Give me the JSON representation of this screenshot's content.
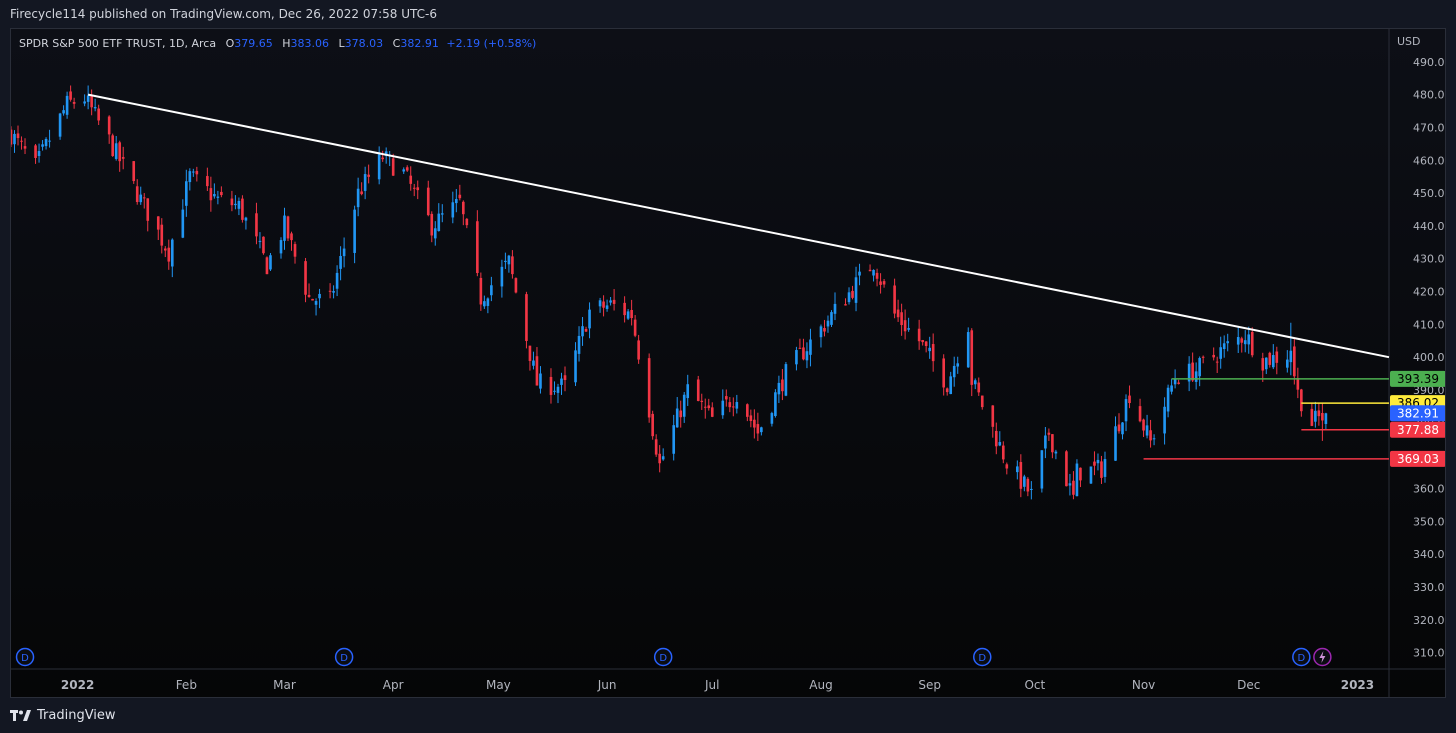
{
  "header": {
    "published_text": "Firecycle114 published on TradingView.com, Dec 26, 2022 07:58 UTC-6"
  },
  "legend": {
    "symbol": "SPDR S&P 500 ETF TRUST, 1D, Arca",
    "o_label": "O",
    "o_value": "379.65",
    "h_label": "H",
    "h_value": "383.06",
    "l_label": "L",
    "l_value": "378.03",
    "c_label": "C",
    "c_value": "382.91",
    "change": "+2.19 (+0.58%)"
  },
  "footer": {
    "brand": "TradingView"
  },
  "colors": {
    "up": "#2196f3",
    "down": "#f23645",
    "background": "#131722",
    "trendline": "#ffffff"
  },
  "chart_data": {
    "type": "candlestick",
    "currency_label": "USD",
    "ylim": [
      305,
      500
    ],
    "y_ticks": [
      310,
      320,
      330,
      340,
      350,
      360,
      370,
      380,
      390,
      400,
      410,
      420,
      430,
      440,
      450,
      460,
      470,
      480,
      490
    ],
    "x_range": [
      "2021-12-13",
      "2023-01-10"
    ],
    "x_ticks": [
      {
        "date": "2022-01-01",
        "label": "2022",
        "bold": true
      },
      {
        "date": "2022-02-01",
        "label": "Feb"
      },
      {
        "date": "2022-03-01",
        "label": "Mar"
      },
      {
        "date": "2022-04-01",
        "label": "Apr"
      },
      {
        "date": "2022-05-01",
        "label": "May"
      },
      {
        "date": "2022-06-01",
        "label": "Jun"
      },
      {
        "date": "2022-07-01",
        "label": "Jul"
      },
      {
        "date": "2022-08-01",
        "label": "Aug"
      },
      {
        "date": "2022-09-01",
        "label": "Sep"
      },
      {
        "date": "2022-10-01",
        "label": "Oct"
      },
      {
        "date": "2022-11-01",
        "label": "Nov"
      },
      {
        "date": "2022-12-01",
        "label": "Dec"
      },
      {
        "date": "2023-01-01",
        "label": "2023",
        "bold": true
      }
    ],
    "close_path": [
      [
        "2021-12-13",
        468
      ],
      [
        "2021-12-20",
        458
      ],
      [
        "2021-12-29",
        477
      ],
      [
        "2022-01-03",
        479
      ],
      [
        "2022-01-10",
        466
      ],
      [
        "2022-01-20",
        446
      ],
      [
        "2022-01-27",
        432
      ],
      [
        "2022-02-02",
        455
      ],
      [
        "2022-02-10",
        448
      ],
      [
        "2022-02-16",
        446
      ],
      [
        "2022-02-24",
        428
      ],
      [
        "2022-03-01",
        440
      ],
      [
        "2022-03-08",
        418
      ],
      [
        "2022-03-14",
        417
      ],
      [
        "2022-03-22",
        450
      ],
      [
        "2022-03-29",
        461
      ],
      [
        "2022-04-04",
        456
      ],
      [
        "2022-04-12",
        440
      ],
      [
        "2022-04-20",
        447
      ],
      [
        "2022-04-26",
        418
      ],
      [
        "2022-05-04",
        429
      ],
      [
        "2022-05-12",
        392
      ],
      [
        "2022-05-20",
        391
      ],
      [
        "2022-05-27",
        414
      ],
      [
        "2022-06-02",
        416
      ],
      [
        "2022-06-08",
        413
      ],
      [
        "2022-06-16",
        367
      ],
      [
        "2022-06-24",
        390
      ],
      [
        "2022-07-01",
        381
      ],
      [
        "2022-07-08",
        389
      ],
      [
        "2022-07-14",
        377
      ],
      [
        "2022-07-22",
        395
      ],
      [
        "2022-08-02",
        410
      ],
      [
        "2022-08-16",
        429
      ],
      [
        "2022-08-22",
        413
      ],
      [
        "2022-08-29",
        405
      ],
      [
        "2022-09-06",
        392
      ],
      [
        "2022-09-12",
        410
      ],
      [
        "2022-09-13",
        393
      ],
      [
        "2022-09-23",
        368
      ],
      [
        "2022-09-30",
        358
      ],
      [
        "2022-10-05",
        377
      ],
      [
        "2022-10-12",
        357
      ],
      [
        "2022-10-13",
        365
      ],
      [
        "2022-10-20",
        366
      ],
      [
        "2022-10-28",
        389
      ],
      [
        "2022-11-03",
        374
      ],
      [
        "2022-11-10",
        394
      ],
      [
        "2022-11-16",
        396
      ],
      [
        "2022-11-23",
        402
      ],
      [
        "2022-11-30",
        407
      ],
      [
        "2022-12-05",
        399
      ],
      [
        "2022-12-13",
        401
      ],
      [
        "2022-12-15",
        389
      ],
      [
        "2022-12-19",
        380
      ],
      [
        "2022-12-23",
        382.91
      ]
    ],
    "volatility": 1.6,
    "highlight_bars": [
      {
        "date": "2022-12-13",
        "open": 398.5,
        "high": 410.5,
        "low": 394.5,
        "close": 401.97
      },
      {
        "date": "2022-12-22",
        "open": 383,
        "high": 386,
        "low": 374.5,
        "close": 380.72
      },
      {
        "date": "2022-12-23",
        "open": 379.65,
        "high": 383.06,
        "low": 378.03,
        "close": 382.91
      }
    ],
    "trendline": {
      "from": [
        "2022-01-04",
        480
      ],
      "to": [
        "2023-01-10",
        400
      ]
    },
    "price_levels": [
      {
        "value": 393.39,
        "label": "393.39",
        "color": "#4caf50",
        "text_color": "#000000",
        "from": "2022-11-09"
      },
      {
        "value": 386.02,
        "label": "386.02",
        "color": "#ffeb3b",
        "text_color": "#000000",
        "from": "2022-12-16"
      },
      {
        "value": 382.91,
        "label": "382.91",
        "color": "#2962ff",
        "text_color": "#ffffff",
        "from": null
      },
      {
        "value": 377.88,
        "label": "377.88",
        "color": "#f23645",
        "text_color": "#ffffff",
        "from": "2022-12-16"
      },
      {
        "value": 369.03,
        "label": "369.03",
        "color": "#f23645",
        "text_color": "#ffffff",
        "from": "2022-11-01"
      }
    ],
    "dividend_markers": [
      {
        "date": "2021-12-17",
        "label": "D"
      },
      {
        "date": "2022-03-18",
        "label": "D"
      },
      {
        "date": "2022-06-17",
        "label": "D"
      },
      {
        "date": "2022-09-16",
        "label": "D"
      },
      {
        "date": "2022-12-16",
        "label": "D"
      }
    ],
    "event_markers": [
      {
        "date": "2022-12-22",
        "icon": "lightning-icon"
      }
    ]
  }
}
